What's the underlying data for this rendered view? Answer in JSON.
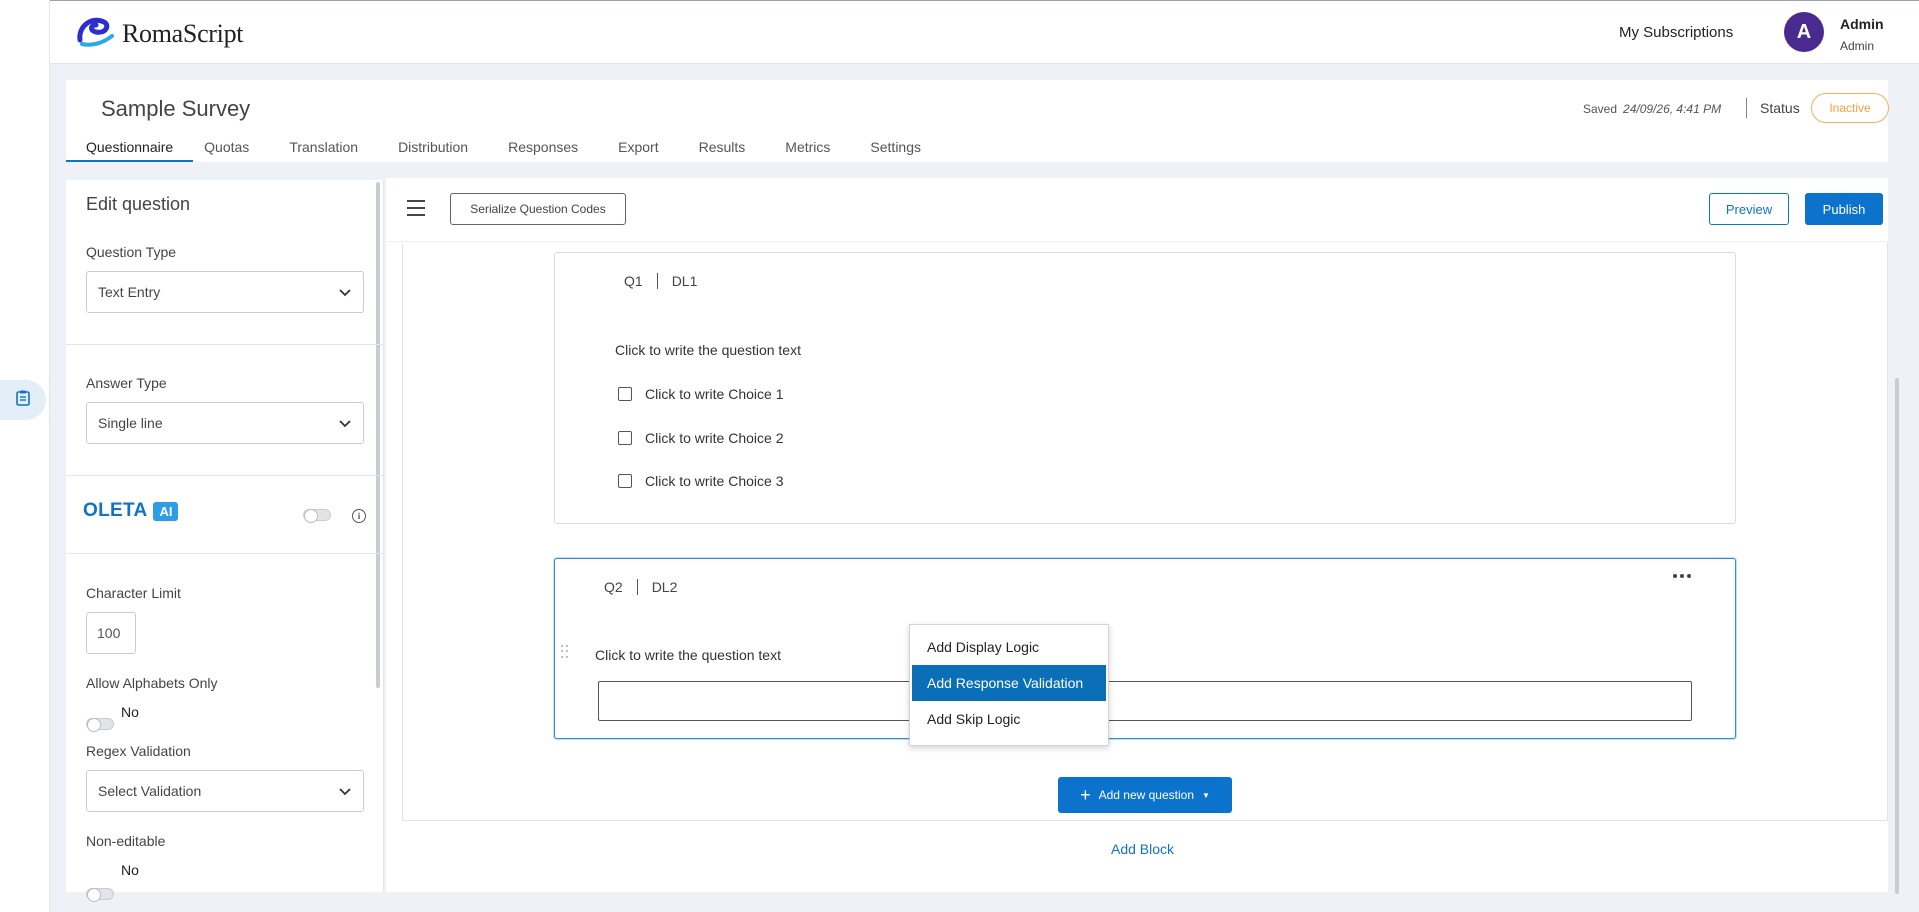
{
  "app": {
    "logo_text": "RomaScript",
    "my_subscriptions": "My Subscriptions",
    "user": {
      "initial": "A",
      "name": "Admin",
      "role": "Admin"
    }
  },
  "survey": {
    "title": "Sample Survey",
    "saved_label": "Saved",
    "saved_time": "24/09/26, 4:41 PM",
    "status_label": "Status",
    "status_value": "Inactive",
    "status_color": "#f0a13b"
  },
  "tabs": [
    {
      "label": "Questionnaire",
      "active": true
    },
    {
      "label": "Quotas"
    },
    {
      "label": "Translation"
    },
    {
      "label": "Distribution"
    },
    {
      "label": "Responses"
    },
    {
      "label": "Export"
    },
    {
      "label": "Results"
    },
    {
      "label": "Metrics"
    },
    {
      "label": "Settings"
    }
  ],
  "edit_panel": {
    "title": "Edit question",
    "question_type_label": "Question Type",
    "question_type_value": "Text Entry",
    "answer_type_label": "Answer Type",
    "answer_type_value": "Single line",
    "oleta_label": "OLETA",
    "ai_badge": "AI",
    "character_limit_label": "Character Limit",
    "character_limit_value": "100",
    "allow_alphabets_label": "Allow Alphabets Only",
    "allow_alphabets_value": "No",
    "regex_label": "Regex Validation",
    "regex_placeholder": "Select Validation",
    "non_editable_label": "Non-editable",
    "non_editable_value": "No"
  },
  "toolbar": {
    "serialize_label": "Serialize Question Codes",
    "preview_label": "Preview",
    "publish_label": "Publish"
  },
  "questions": [
    {
      "code": "Q1",
      "dl": "DL1",
      "text": "Click to write the question text",
      "choices": [
        "Click to write Choice 1",
        "Click to write Choice 2",
        "Click to write Choice 3"
      ]
    },
    {
      "code": "Q2",
      "dl": "DL2",
      "text": "Click to write the question text"
    }
  ],
  "context_menu": {
    "items": [
      "Add Display Logic",
      "Add Response Validation",
      "Add Skip Logic"
    ],
    "highlighted_index": 1
  },
  "actions": {
    "add_new_question": "Add new question",
    "add_block": "Add Block"
  },
  "colors": {
    "brand_blue": "#0b73cc",
    "avatar": "#4b2a8f",
    "menu_highlight": "#0b6fb8"
  }
}
